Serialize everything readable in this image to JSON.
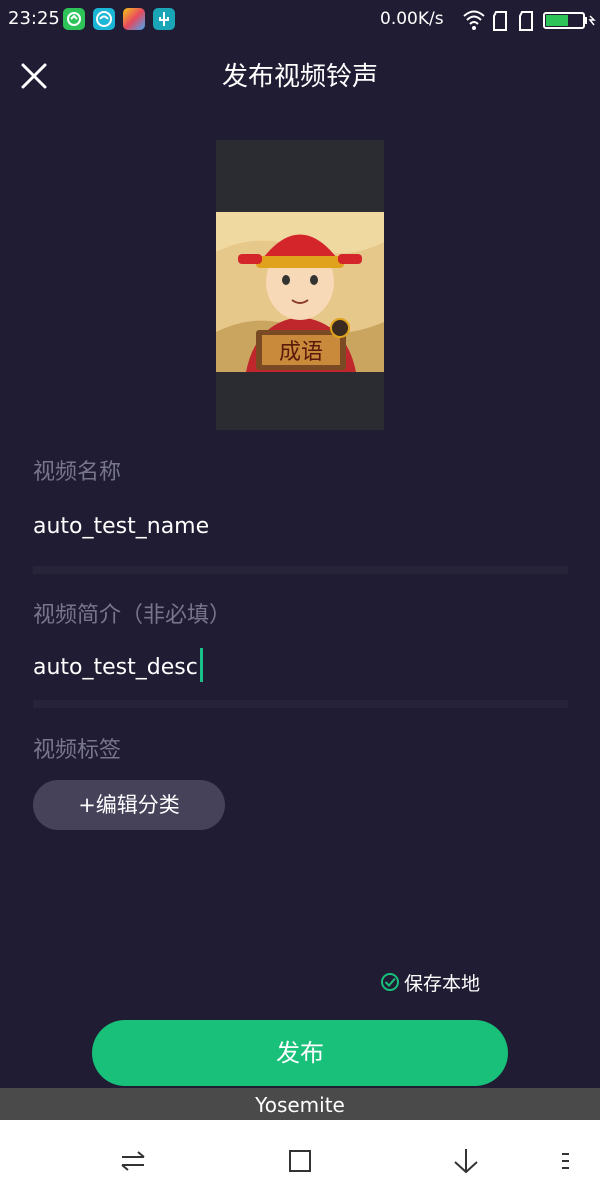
{
  "status_bar": {
    "time": "23:25",
    "net_speed": "0.00K/s",
    "icons": [
      "app-icon-green",
      "app-icon-cyan",
      "app-icon-colorful",
      "usb-icon",
      "wifi-icon",
      "sim1-icon",
      "sim2-icon",
      "battery-icon"
    ],
    "battery_level": 0.6
  },
  "header": {
    "title": "发布视频铃声",
    "close_icon": "close-icon"
  },
  "form": {
    "name_label": "视频名称",
    "name_value": "auto_test_name",
    "desc_label": "视频简介（非必填）",
    "desc_value": "auto_test_desc",
    "tags_label": "视频标签",
    "edit_category_label": "+编辑分类"
  },
  "save_local": {
    "label": "保存本地",
    "checked": true
  },
  "publish_button": {
    "label": "发布"
  },
  "overlay": {
    "text": "Yosemite"
  },
  "nav_bar": {
    "icons": [
      "swap-icon",
      "square-icon",
      "down-arrow-icon",
      "menu-icon"
    ]
  },
  "thumbnail": {
    "caption_chars": "成语"
  },
  "colors": {
    "background": "#1f1c33",
    "accent": "#19c07a",
    "label": "#78768b",
    "tag_button": "#45425a"
  }
}
